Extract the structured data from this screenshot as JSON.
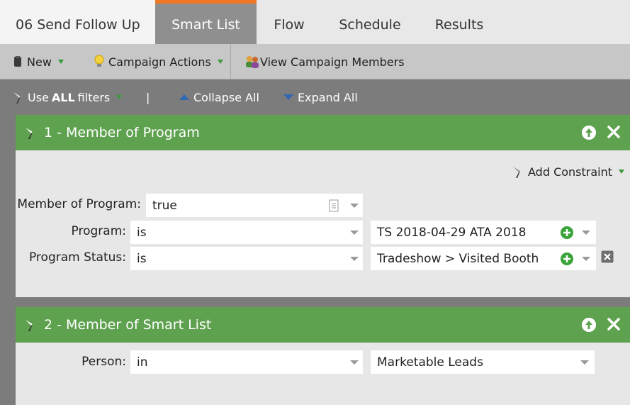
{
  "tabs": {
    "campaign": "06 Send Follow Up",
    "smart_list": "Smart List",
    "flow": "Flow",
    "schedule": "Schedule",
    "results": "Results"
  },
  "toolbar": {
    "new_label": "New",
    "campaign_actions_label": "Campaign Actions",
    "view_members_label": "View Campaign Members"
  },
  "filterbar": {
    "use_label": "Use",
    "all_label": "ALL",
    "filters_label": "filters",
    "separator": "|",
    "collapse_label": "Collapse All",
    "expand_label": "Expand All"
  },
  "filter1": {
    "title": "1 - Member of Program",
    "add_constraint": "Add Constraint",
    "member_label": "Member of Program:",
    "member_value": "true",
    "program_label": "Program:",
    "program_operator": "is",
    "program_value": "TS 2018-04-29 ATA 2018",
    "status_label": "Program Status:",
    "status_operator": "is",
    "status_value": "Tradeshow > Visited Booth"
  },
  "filter2": {
    "title": "2 - Member of Smart List",
    "person_label": "Person:",
    "person_operator": "in",
    "person_value": "Marketable Leads"
  },
  "colors": {
    "accent_orange": "#f07822",
    "panel_green": "#5ea14f",
    "plus_green": "#3aa43a"
  }
}
